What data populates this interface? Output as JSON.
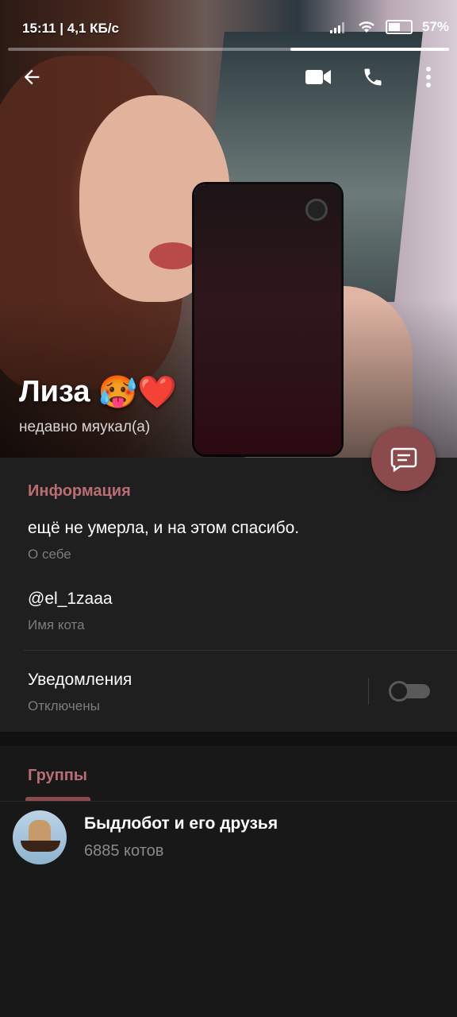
{
  "status_bar": {
    "time": "15:11",
    "network_speed": "4,1 КБ/с",
    "battery": "57%"
  },
  "story_progress": 0.36,
  "profile": {
    "name": "Лиза",
    "name_emojis": "🥵❤️",
    "last_seen": "недавно мяукал(а)"
  },
  "info": {
    "header": "Информация",
    "bio": "ещё не умерла, и на этом спасибо.",
    "bio_label": "О себе",
    "username": "@el_1zaaa",
    "username_label": "Имя кота",
    "notifications": "Уведомления",
    "notifications_status": "Отключены",
    "notifications_enabled": false
  },
  "groups": {
    "header": "Группы",
    "items": [
      {
        "name": "Быдлобот и его друзья",
        "members": "6885 котов"
      }
    ]
  },
  "colors": {
    "accent": "#8b4a4c",
    "header_text": "#b86e72",
    "background": "#181818",
    "section_bg": "#1f1f1f"
  }
}
